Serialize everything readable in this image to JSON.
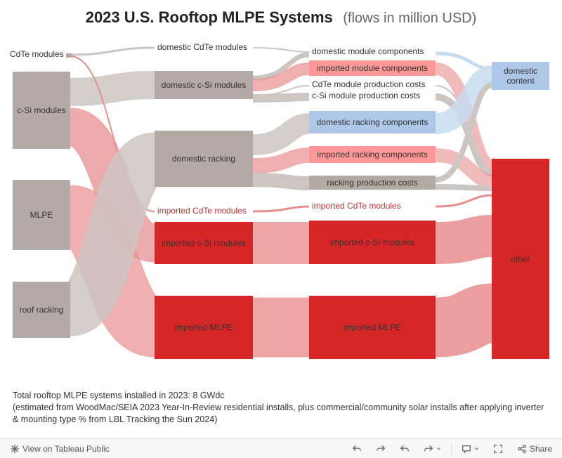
{
  "title": {
    "main": "2023 U.S. Rooftop MLPE Systems",
    "sub": "(flows in million USD)"
  },
  "chart_data": {
    "type": "sankey",
    "columns": [
      [
        "CdTe modules",
        "c-Si modules",
        "MLPE",
        "roof racking"
      ],
      [
        "domestic CdTe modules",
        "domestic c-Si modules",
        "domestic racking",
        "imported CdTe modules",
        "imported c-Si modules",
        "imported MLPE"
      ],
      [
        "domestic module components",
        "imported module components",
        "CdTe module production costs",
        "c-Si module production costs",
        "domestic racking components",
        "imported racking components",
        "racking production costs",
        "imported CdTe modules",
        "imported c-Si modules",
        "imported MLPE"
      ],
      [
        "domestic content",
        "other"
      ]
    ],
    "nodes": [
      {
        "name": "CdTe modules",
        "col": 0,
        "color": "grey",
        "value": 30
      },
      {
        "name": "c-Si modules",
        "col": 0,
        "color": "grey",
        "value": 1300
      },
      {
        "name": "MLPE",
        "col": 0,
        "color": "grey",
        "value": 1100
      },
      {
        "name": "roof racking",
        "col": 0,
        "color": "grey",
        "value": 800
      },
      {
        "name": "domestic CdTe modules",
        "col": 1,
        "color": "grey",
        "value": 20
      },
      {
        "name": "domestic c-Si modules",
        "col": 1,
        "color": "grey",
        "value": 400
      },
      {
        "name": "domestic racking",
        "col": 1,
        "color": "grey",
        "value": 800
      },
      {
        "name": "imported CdTe modules",
        "col": 1,
        "color": "red",
        "value": 10
      },
      {
        "name": "imported c-Si modules",
        "col": 1,
        "color": "red",
        "value": 900
      },
      {
        "name": "imported MLPE",
        "col": 1,
        "color": "red",
        "value": 1100
      },
      {
        "name": "domestic module components",
        "col": 2,
        "color": "grey",
        "value": 60
      },
      {
        "name": "imported module components",
        "col": 2,
        "color": "red-light",
        "value": 200
      },
      {
        "name": "CdTe module production costs",
        "col": 2,
        "color": "grey",
        "value": 10
      },
      {
        "name": "c-Si module production costs",
        "col": 2,
        "color": "grey",
        "value": 140
      },
      {
        "name": "domestic racking components",
        "col": 2,
        "color": "blue-light",
        "value": 400
      },
      {
        "name": "imported racking components",
        "col": 2,
        "color": "red-light",
        "value": 200
      },
      {
        "name": "racking production costs",
        "col": 2,
        "color": "grey",
        "value": 200
      },
      {
        "name": "imported CdTe modules",
        "col": 2,
        "color": "red",
        "value": 10
      },
      {
        "name": "imported c-Si modules",
        "col": 2,
        "color": "red",
        "value": 900
      },
      {
        "name": "imported MLPE",
        "col": 2,
        "color": "red",
        "value": 1100
      },
      {
        "name": "domestic content",
        "col": 3,
        "color": "blue-light",
        "value": 600
      },
      {
        "name": "other",
        "col": 3,
        "color": "red",
        "value": 2600
      }
    ],
    "links": [
      {
        "source": "CdTe modules",
        "target": "domestic CdTe modules",
        "value": 20,
        "color": "grey"
      },
      {
        "source": "CdTe modules",
        "target": "imported CdTe modules",
        "value": 10,
        "color": "red"
      },
      {
        "source": "c-Si modules",
        "target": "domestic c-Si modules",
        "value": 400,
        "color": "grey"
      },
      {
        "source": "c-Si modules",
        "target": "imported c-Si modules",
        "value": 900,
        "color": "red"
      },
      {
        "source": "MLPE",
        "target": "imported MLPE",
        "value": 1100,
        "color": "red"
      },
      {
        "source": "roof racking",
        "target": "domestic racking",
        "value": 800,
        "color": "grey"
      },
      {
        "source": "domestic CdTe modules",
        "target": "domestic module components",
        "value": 10,
        "color": "grey"
      },
      {
        "source": "domestic CdTe modules",
        "target": "CdTe module production costs",
        "value": 10,
        "color": "grey"
      },
      {
        "source": "domestic c-Si modules",
        "target": "domestic module components",
        "value": 50,
        "color": "grey"
      },
      {
        "source": "domestic c-Si modules",
        "target": "imported module components",
        "value": 200,
        "color": "red"
      },
      {
        "source": "domestic c-Si modules",
        "target": "c-Si module production costs",
        "value": 140,
        "color": "grey"
      },
      {
        "source": "domestic racking",
        "target": "domestic racking components",
        "value": 400,
        "color": "blue"
      },
      {
        "source": "domestic racking",
        "target": "imported racking components",
        "value": 200,
        "color": "red"
      },
      {
        "source": "domestic racking",
        "target": "racking production costs",
        "value": 200,
        "color": "grey"
      },
      {
        "source": "imported CdTe modules",
        "target": "imported CdTe modules",
        "value": 10,
        "color": "red"
      },
      {
        "source": "imported c-Si modules",
        "target": "imported c-Si modules",
        "value": 900,
        "color": "red"
      },
      {
        "source": "imported MLPE",
        "target": "imported MLPE",
        "value": 1100,
        "color": "red"
      },
      {
        "source": "domestic module components",
        "target": "domestic content",
        "value": 60,
        "color": "blue"
      },
      {
        "source": "imported module components",
        "target": "other",
        "value": 200,
        "color": "red"
      },
      {
        "source": "CdTe module production costs",
        "target": "other",
        "value": 10,
        "color": "grey"
      },
      {
        "source": "c-Si module production costs",
        "target": "other",
        "value": 140,
        "color": "grey"
      },
      {
        "source": "domestic racking components",
        "target": "domestic content",
        "value": 400,
        "color": "blue"
      },
      {
        "source": "imported racking components",
        "target": "other",
        "value": 200,
        "color": "red"
      },
      {
        "source": "racking production costs",
        "target": "domestic content",
        "value": 100,
        "color": "grey"
      },
      {
        "source": "racking production costs",
        "target": "other",
        "value": 100,
        "color": "grey"
      },
      {
        "source": "imported CdTe modules",
        "target": "other",
        "value": 10,
        "color": "red"
      },
      {
        "source": "imported c-Si modules",
        "target": "other",
        "value": 900,
        "color": "red"
      },
      {
        "source": "imported MLPE",
        "target": "other",
        "value": 1100,
        "color": "red"
      }
    ]
  },
  "nodes_labels": {
    "cdte": "CdTe modules",
    "csi": "c-Si modules",
    "mlpe": "MLPE",
    "racking": "roof racking",
    "dom_cdte": "domestic CdTe modules",
    "dom_csi": "domestic c-Si modules",
    "dom_rack": "domestic racking",
    "imp_cdte": "imported CdTe modules",
    "imp_csi": "imported c-Si modules",
    "imp_mlpe": "imported MLPE",
    "dom_mod_comp": "domestic module components",
    "imp_mod_comp": "imported module components",
    "cdte_prod_cost": "CdTe module production costs",
    "csi_prod_cost": "c-Si module production costs",
    "dom_rack_comp": "domestic racking components",
    "imp_rack_comp": "imported racking components",
    "rack_prod_cost": "racking production costs",
    "imp_cdte2": "imported CdTe modules",
    "imp_csi2": "imported c-Si modules",
    "imp_mlpe2": "imported MLPE",
    "dom_content": "domestic content",
    "other": "other"
  },
  "footnote": {
    "line1": "Total rooftop MLPE systems installed in 2023: 8 GWdc",
    "line2": "(estimated from WoodMac/SEIA 2023 Year-In-Review residential installs, plus commercial/community solar installs after applying inverter & mounting type % from LBL Tracking the Sun 2024)"
  },
  "toolbar": {
    "view_public": "View on Tableau Public",
    "share": "Share"
  }
}
